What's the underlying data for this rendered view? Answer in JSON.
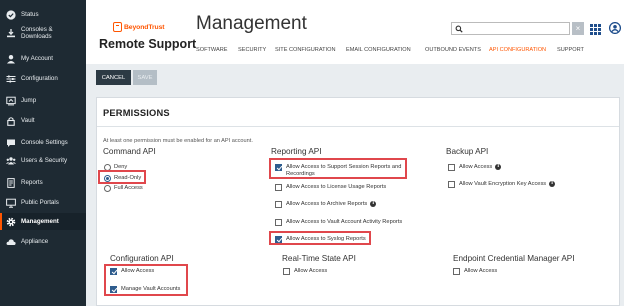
{
  "sidebar": {
    "items": [
      {
        "label": "Status",
        "icon": "check-circle-icon"
      },
      {
        "label": "Consoles &\nDownloads",
        "icon": "download-icon"
      },
      {
        "label": "My Account",
        "icon": "user-icon"
      },
      {
        "label": "Configuration",
        "icon": "sliders-icon"
      },
      {
        "label": "Jump",
        "icon": "jump-icon"
      },
      {
        "label": "Vault",
        "icon": "lock-icon"
      },
      {
        "label": "Console Settings",
        "icon": "chat-icon"
      },
      {
        "label": "Users & Security",
        "icon": "users-icon"
      },
      {
        "label": "Reports",
        "icon": "report-icon"
      },
      {
        "label": "Public Portals",
        "icon": "monitor-icon"
      },
      {
        "label": "Management",
        "icon": "gear-icon",
        "active": true
      },
      {
        "label": "Appliance",
        "icon": "cloud-icon"
      }
    ]
  },
  "header": {
    "brand": "BeyondTrust",
    "product": "Remote Support",
    "title": "Management",
    "search_placeholder": "",
    "clear_label": "×",
    "tabs": [
      {
        "label": "SOFTWARE"
      },
      {
        "label": "SECURITY"
      },
      {
        "label": "SITE CONFIGURATION"
      },
      {
        "label": "EMAIL CONFIGURATION"
      },
      {
        "label": "OUTBOUND EVENTS"
      },
      {
        "label": "API CONFIGURATION",
        "active": true
      },
      {
        "label": "SUPPORT"
      }
    ]
  },
  "toolbar": {
    "cancel_label": "CANCEL",
    "save_label": "SAVE"
  },
  "permissions": {
    "title": "PERMISSIONS",
    "note": "At least one permission must be enabled for an API account.",
    "command_api": {
      "title": "Command API",
      "options": [
        {
          "label": "Deny",
          "selected": false
        },
        {
          "label": "Read-Only",
          "selected": true
        },
        {
          "label": "Full Access",
          "selected": false
        }
      ]
    },
    "reporting_api": {
      "title": "Reporting API",
      "options": [
        {
          "label": "Allow Access to Support Session Reports and Recordings",
          "checked": true
        },
        {
          "label": "Allow Access to License Usage Reports",
          "checked": false
        },
        {
          "label": "Allow Access to Archive Reports",
          "checked": false
        },
        {
          "label": "Allow Access to Vault Account Activity Reports",
          "checked": false
        },
        {
          "label": "Allow Access to Syslog Reports",
          "checked": true
        }
      ]
    },
    "backup_api": {
      "title": "Backup API",
      "options": [
        {
          "label": "Allow Access",
          "checked": false
        },
        {
          "label": "Allow Vault Encryption Key Access",
          "checked": false
        }
      ]
    },
    "configuration_api": {
      "title": "Configuration API",
      "options": [
        {
          "label": "Allow Access",
          "checked": true
        },
        {
          "label": "Manage Vault Accounts",
          "checked": true
        }
      ]
    },
    "realtime_api": {
      "title": "Real-Time State API",
      "options": [
        {
          "label": "Allow Access",
          "checked": false
        }
      ]
    },
    "endpoint_api": {
      "title": "Endpoint Credential Manager API",
      "options": [
        {
          "label": "Allow Access",
          "checked": false
        }
      ]
    }
  },
  "colors": {
    "accent": "#ff5500",
    "sidebar": "#1e2a33",
    "highlight": "#e0474c",
    "checkbox": "#2f5d8e"
  }
}
